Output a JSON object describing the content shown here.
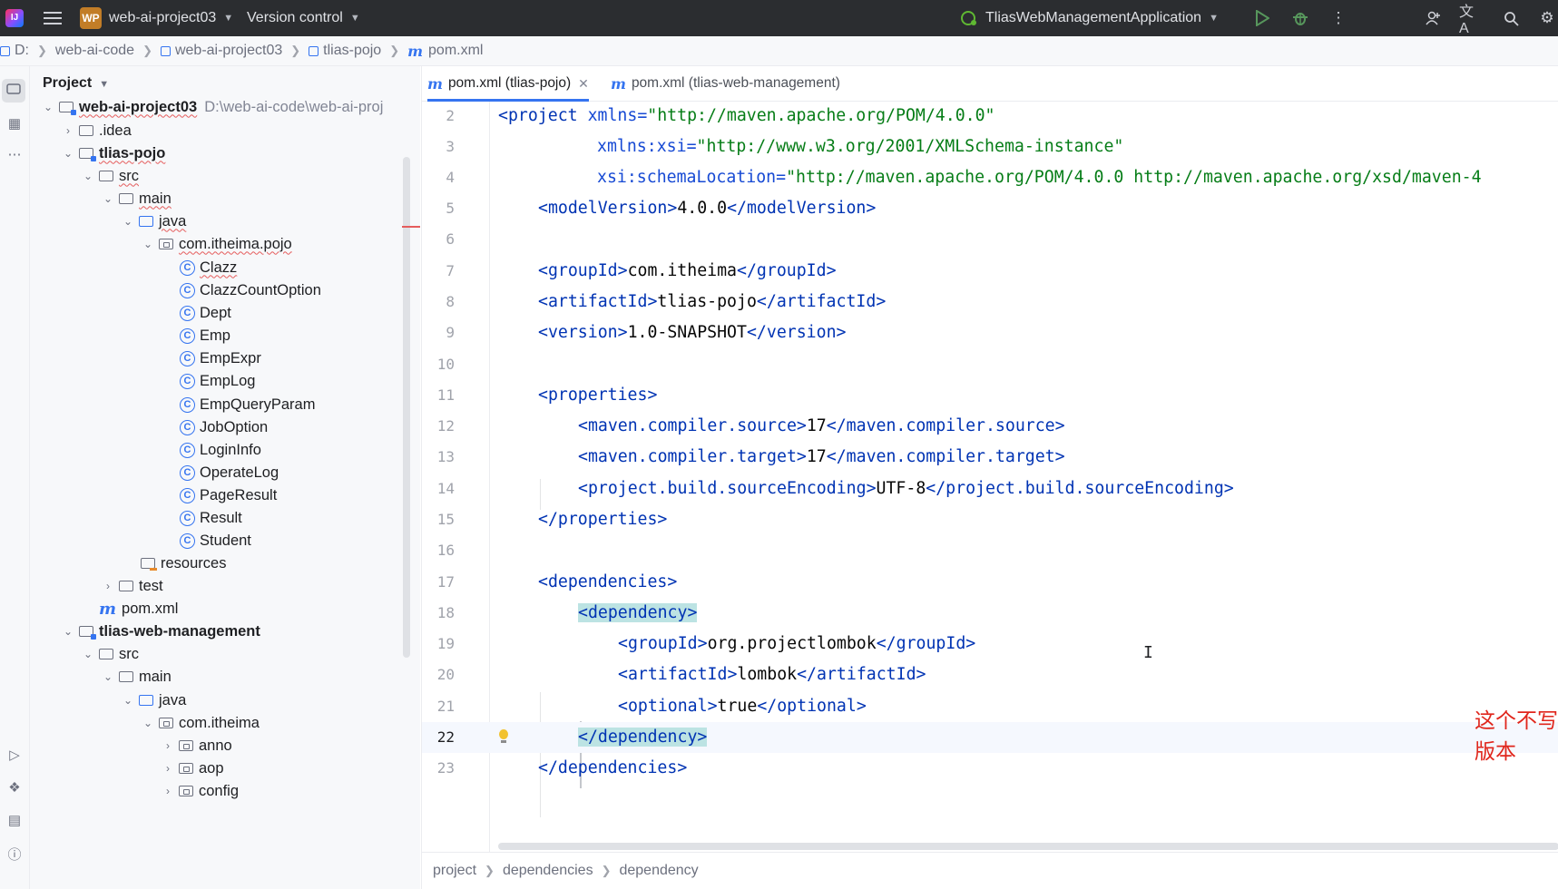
{
  "titlebar": {
    "project_name": "web-ai-project03",
    "project_badge": "WP",
    "vcs_label": "Version control",
    "run_config": "TliasWebManagementApplication"
  },
  "breadcrumb": [
    "D:",
    "web-ai-code",
    "web-ai-project03",
    "tlias-pojo",
    "pom.xml"
  ],
  "project_panel": {
    "title": "Project",
    "root_path": "D:\\web-ai-code\\web-ai-proj",
    "tree": [
      {
        "label": "web-ai-project03",
        "icon": "module-folder-icon",
        "expanded": true
      },
      {
        "label": ".idea",
        "icon": "folder-icon",
        "expanded": false
      },
      {
        "label": "tlias-pojo",
        "icon": "module-folder-icon",
        "expanded": true
      },
      {
        "label": "src",
        "icon": "folder-icon",
        "expanded": true
      },
      {
        "label": "main",
        "icon": "folder-icon",
        "expanded": true
      },
      {
        "label": "java",
        "icon": "source-folder-icon",
        "expanded": true
      },
      {
        "label": "com.itheima.pojo",
        "icon": "package-icon",
        "expanded": true
      },
      {
        "label": "Clazz",
        "icon": "class-icon"
      },
      {
        "label": "ClazzCountOption",
        "icon": "class-icon"
      },
      {
        "label": "Dept",
        "icon": "class-icon"
      },
      {
        "label": "Emp",
        "icon": "class-icon"
      },
      {
        "label": "EmpExpr",
        "icon": "class-icon"
      },
      {
        "label": "EmpLog",
        "icon": "class-icon"
      },
      {
        "label": "EmpQueryParam",
        "icon": "class-icon"
      },
      {
        "label": "JobOption",
        "icon": "class-icon"
      },
      {
        "label": "LoginInfo",
        "icon": "class-icon"
      },
      {
        "label": "OperateLog",
        "icon": "class-icon"
      },
      {
        "label": "PageResult",
        "icon": "class-icon"
      },
      {
        "label": "Result",
        "icon": "class-icon"
      },
      {
        "label": "Student",
        "icon": "class-icon"
      },
      {
        "label": "resources",
        "icon": "resources-folder-icon"
      },
      {
        "label": "test",
        "icon": "folder-icon",
        "expanded": false
      },
      {
        "label": "pom.xml",
        "icon": "maven-icon"
      },
      {
        "label": "tlias-web-management",
        "icon": "module-folder-icon",
        "expanded": true
      },
      {
        "label": "src",
        "icon": "folder-icon",
        "expanded": true
      },
      {
        "label": "main",
        "icon": "folder-icon",
        "expanded": true
      },
      {
        "label": "java",
        "icon": "source-folder-icon",
        "expanded": true
      },
      {
        "label": "com.itheima",
        "icon": "package-icon",
        "expanded": true
      },
      {
        "label": "anno",
        "icon": "package-icon",
        "expanded": false
      },
      {
        "label": "aop",
        "icon": "package-icon",
        "expanded": false
      },
      {
        "label": "config",
        "icon": "package-icon",
        "expanded": false
      }
    ]
  },
  "tabs": [
    {
      "label": "pom.xml (tlias-pojo)",
      "active": true
    },
    {
      "label": "pom.xml (tlias-web-management)",
      "active": false
    }
  ],
  "editor": {
    "lines": [
      2,
      3,
      4,
      5,
      6,
      7,
      8,
      9,
      10,
      11,
      12,
      13,
      14,
      15,
      16,
      17,
      18,
      19,
      20,
      21,
      22,
      23
    ],
    "caret_line": 22,
    "code": {
      "l2": {
        "open": "<",
        "tag": "project",
        "attr": "xmlns",
        "val": "\"http://maven.apache.org/POM/4.0.0\""
      },
      "l3": {
        "attr": "xmlns:xsi",
        "val": "\"http://www.w3.org/2001/XMLSchema-instance\""
      },
      "l4": {
        "attr": "xsi:schemaLocation",
        "val": "\"http://maven.apache.org/POM/4.0.0 http://maven.apache.org/xsd/maven-4"
      },
      "l5": {
        "tag": "modelVersion",
        "text": "4.0.0"
      },
      "l7": {
        "tag": "groupId",
        "text": "com.itheima"
      },
      "l8": {
        "tag": "artifactId",
        "text": "tlias-pojo"
      },
      "l9": {
        "tag": "version",
        "text": "1.0-SNAPSHOT"
      },
      "l11": {
        "tag": "properties"
      },
      "l12": {
        "tag": "maven.compiler.source",
        "text": "17"
      },
      "l13": {
        "tag": "maven.compiler.target",
        "text": "17"
      },
      "l14": {
        "tag": "project.build.sourceEncoding",
        "text": "UTF-8"
      },
      "l15": {
        "tag": "properties"
      },
      "l17": {
        "tag": "dependencies"
      },
      "l18": {
        "tag": "dependency"
      },
      "l19": {
        "tag": "groupId",
        "text": "org.projectlombok"
      },
      "l20": {
        "tag": "artifactId",
        "text": "lombok"
      },
      "l21": {
        "tag": "optional",
        "text": "true"
      },
      "l22": {
        "tag": "dependency"
      },
      "l23": {
        "tag": "dependencies"
      }
    }
  },
  "annotation": "这个不写版本",
  "bottom_breadcrumb": [
    "project",
    "dependencies",
    "dependency"
  ],
  "colors": {
    "tag": "#0033b3",
    "attr_value": "#067d17",
    "accent": "#3574f0",
    "annotation": "#e0261c",
    "match_highlight": "#bce3e3"
  }
}
